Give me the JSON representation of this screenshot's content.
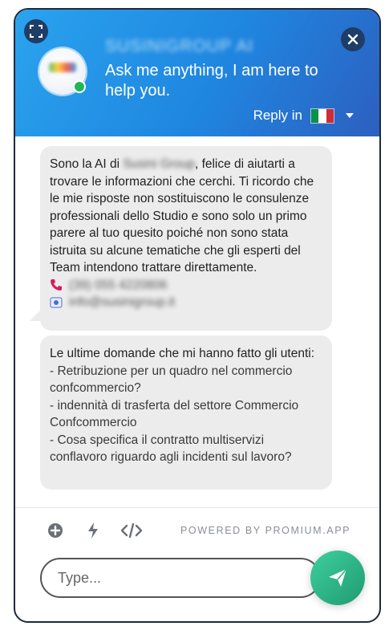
{
  "header": {
    "brand_name": "SUSINIGROUP AI",
    "tagline": "Ask me anything, I am here to help you.",
    "reply_in_label": "Reply in",
    "language_flag_colors": [
      "#0a9246",
      "#ffffff",
      "#ce2b37"
    ]
  },
  "messages": [
    {
      "text_before": "Sono la AI di ",
      "company": "Susini Group",
      "text_after": ", felice di aiutarti a trovare le informazioni che cerchi. Ti ricordo che le mie risposte non sostituiscono le consulenze professionali dello Studio e sono solo un primo parere al tuo quesito poiché non sono stata istruita su alcune tematiche che gli esperti del Team intendono trattare direttamente.",
      "phone": "(39) 055 4220806",
      "email": "info@susinigroup.it"
    },
    {
      "intro": "Le ultime domande che mi hanno fatto gli utenti:",
      "questions": [
        "- Retribuzione per un quadro nel commercio confcommercio?",
        "- indennità di trasferta del settore Commercio Confcommercio",
        "- Cosa specifica il contratto multiservizi conflavoro riguardo agli incidenti sul lavoro?"
      ]
    }
  ],
  "toolbar": {
    "powered_by": "POWERED BY PROMIUM.APP"
  },
  "composer": {
    "placeholder": "Type..."
  },
  "colors": {
    "header_gradient_start": "#2aa3ee",
    "header_gradient_end": "#2d5fbf",
    "bubble_bg": "#ececec",
    "send_button": "#2bb585",
    "online": "#22b55a"
  }
}
